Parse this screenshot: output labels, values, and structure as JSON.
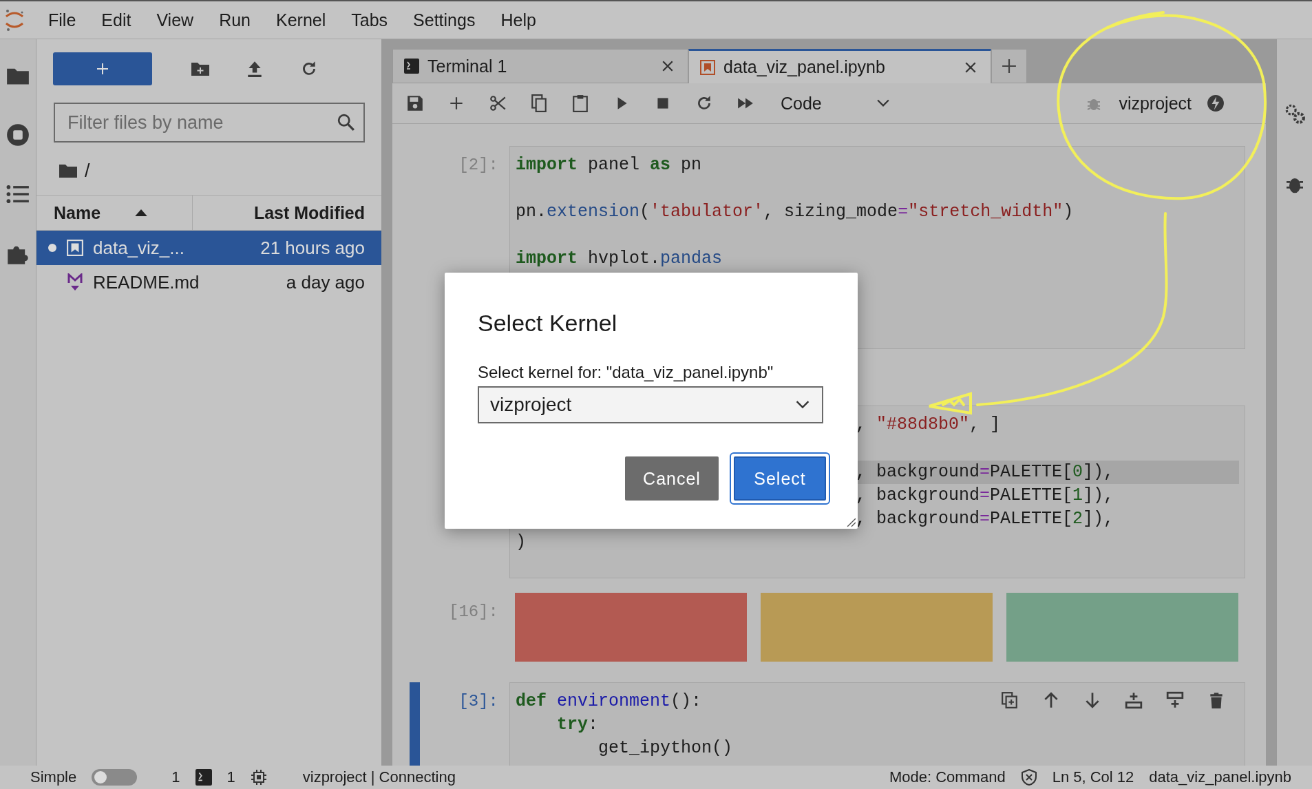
{
  "menu": [
    "File",
    "Edit",
    "View",
    "Run",
    "Kernel",
    "Tabs",
    "Settings",
    "Help"
  ],
  "file_browser": {
    "filter_placeholder": "Filter files by name",
    "path": "/",
    "columns": [
      {
        "label": "Name",
        "sorted": true
      },
      {
        "label": "Last Modified",
        "sorted": false
      }
    ],
    "files": [
      {
        "name": "data_viz_...",
        "modified": "21 hours ago",
        "kind": "notebook",
        "selected": true,
        "running": true
      },
      {
        "name": "README.md",
        "modified": "a day ago",
        "kind": "markdown",
        "selected": false,
        "running": false
      }
    ]
  },
  "tabs": [
    {
      "label": "Terminal 1",
      "kind": "terminal",
      "selected": false
    },
    {
      "label": "data_viz_panel.ipynb",
      "kind": "notebook",
      "selected": true
    }
  ],
  "toolbar": {
    "cell_type": "Code",
    "kernel": "vizproject"
  },
  "cells": [
    {
      "kind": "code",
      "prompt": "[2]:",
      "active": false,
      "lines": [
        {
          "covered": false,
          "highlighted": false,
          "tokens": [
            {
              "t": "import",
              "kind": "kw"
            },
            {
              "t": " panel ",
              "kind": "n"
            },
            {
              "t": "as",
              "kind": "kw"
            },
            {
              "t": " pn",
              "kind": "n"
            }
          ]
        },
        {
          "covered": false,
          "highlighted": false,
          "tokens": [
            {
              "t": "pn.",
              "kind": "n"
            },
            {
              "t": "extension",
              "kind": "fn"
            },
            {
              "t": "(",
              "kind": "n"
            },
            {
              "t": "'tabulator'",
              "kind": "str"
            },
            {
              "t": ", sizing_mode",
              "kind": "n"
            },
            {
              "t": "=",
              "kind": "op"
            },
            {
              "t": "\"stretch_width\"",
              "kind": "str"
            },
            {
              "t": ")",
              "kind": "n"
            }
          ]
        },
        {
          "covered": false,
          "highlighted": false,
          "tokens": [
            {
              "t": "import",
              "kind": "kw"
            },
            {
              "t": " hvplot.",
              "kind": "n"
            },
            {
              "t": "pandas",
              "kind": "fn"
            }
          ]
        }
      ]
    },
    {
      "kind": "code",
      "active": false,
      "lines": [
        {
          "covered": true,
          "highlighted": false,
          "tokens": [
            {
              "t": ", ",
              "kind": "n"
            },
            {
              "t": "\"#88d8b0\"",
              "kind": "str"
            },
            {
              "t": ", ]",
              "kind": "n"
            }
          ]
        },
        {
          "covered": true,
          "highlighted": true,
          "tokens": [
            {
              "t": ", background",
              "kind": "n"
            },
            {
              "t": "=",
              "kind": "op"
            },
            {
              "t": "PALETTE[",
              "kind": "n"
            },
            {
              "t": "0",
              "kind": "num"
            },
            {
              "t": "]),",
              "kind": "n"
            }
          ]
        },
        {
          "covered": true,
          "highlighted": false,
          "tokens": [
            {
              "t": ", background",
              "kind": "n"
            },
            {
              "t": "=",
              "kind": "op"
            },
            {
              "t": "PALETTE[",
              "kind": "n"
            },
            {
              "t": "1",
              "kind": "num"
            },
            {
              "t": "]),",
              "kind": "n"
            }
          ]
        },
        {
          "covered": true,
          "highlighted": false,
          "tokens": [
            {
              "t": ", background",
              "kind": "n"
            },
            {
              "t": "=",
              "kind": "op"
            },
            {
              "t": "PALETTE[",
              "kind": "n"
            },
            {
              "t": "2",
              "kind": "num"
            },
            {
              "t": "]),",
              "kind": "n"
            }
          ]
        },
        {
          "covered": false,
          "highlighted": false,
          "tokens": [
            {
              "t": ")",
              "kind": "n"
            }
          ]
        }
      ]
    },
    {
      "kind": "swatches",
      "prompt": "[16]:",
      "active": false,
      "swatches": [
        {
          "color": "#b35a52"
        },
        {
          "color": "#b89a55"
        },
        {
          "color": "#74a088"
        }
      ]
    },
    {
      "kind": "code",
      "prompt": "[3]:",
      "active": true,
      "lines": [
        {
          "covered": false,
          "highlighted": false,
          "tokens": [
            {
              "t": "def",
              "kind": "kw"
            },
            {
              "t": " environment",
              "kind": "def"
            },
            {
              "t": "():",
              "kind": "n"
            }
          ]
        },
        {
          "covered": false,
          "highlighted": false,
          "tokens": [
            {
              "t": "    try",
              "kind": "kw"
            },
            {
              "t": ":",
              "kind": "n"
            }
          ]
        },
        {
          "covered": false,
          "highlighted": false,
          "tokens": [
            {
              "t": "        get_ipython()",
              "kind": "n"
            }
          ]
        }
      ]
    }
  ],
  "dialog": {
    "title": "Select Kernel",
    "label": "Select kernel for: \"data_viz_panel.ipynb\"",
    "value": "vizproject",
    "buttons": [
      {
        "label": "Cancel",
        "kind": "secondary"
      },
      {
        "label": "Select",
        "kind": "primary"
      }
    ]
  },
  "status_bar": {
    "mode_label": "Simple",
    "simple_mode": false,
    "terminals": "1",
    "kernels": "1",
    "kernel_status": "vizproject | Connecting",
    "mode": "Mode: Command",
    "position": "Ln 5, Col 12",
    "file": "data_viz_panel.ipynb"
  }
}
